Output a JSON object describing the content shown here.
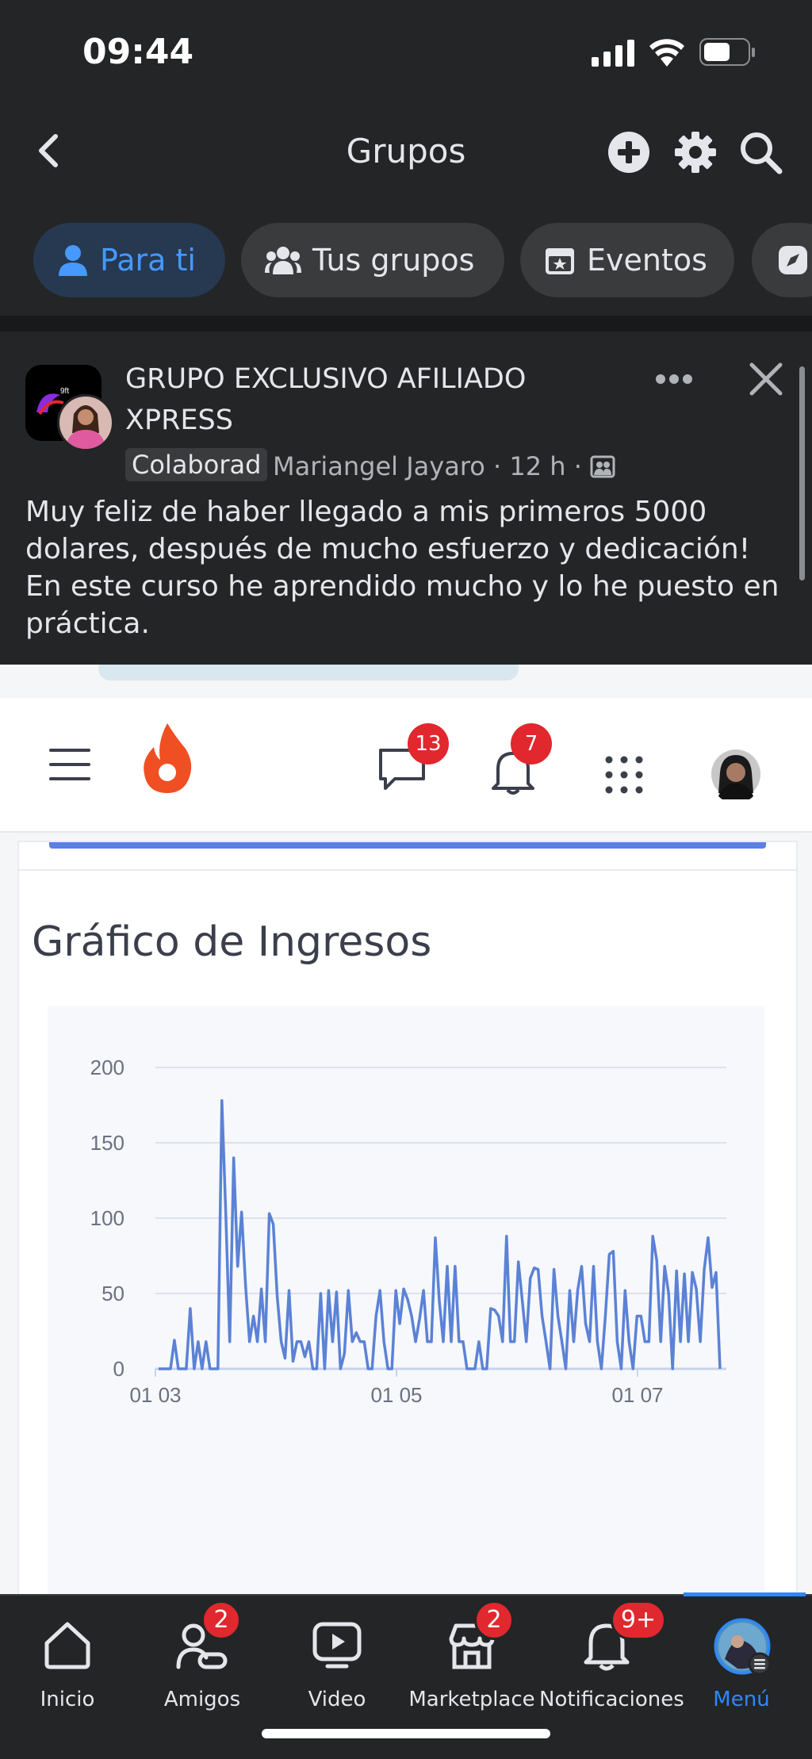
{
  "status_bar": {
    "time": "09:44"
  },
  "header": {
    "title": "Grupos",
    "back_icon": "chevron-left-icon",
    "actions": [
      "add-icon",
      "gear-icon",
      "search-icon"
    ]
  },
  "tabs": [
    {
      "label": "Para ti",
      "icon": "person-icon",
      "active": true
    },
    {
      "label": "Tus grupos",
      "icon": "people-icon",
      "active": false
    },
    {
      "label": "Eventos",
      "icon": "calendar-star-icon",
      "active": false
    },
    {
      "label": "",
      "icon": "compass-icon",
      "active": false
    }
  ],
  "post": {
    "group_name": "GRUPO EXCLUSIVO AFILIADO XPRESS",
    "badge": "Colaborad",
    "author": "Mariangel Jayaro",
    "time": "12 h",
    "separator": "·",
    "privacy_icon": "group-privacy-icon",
    "text": "Muy feliz de haber llegado a mis primeros 5000 dolares, después de mucho esfuerzo y dedicación! En este curso he aprendido mucho y lo he puesto en práctica.",
    "image": {
      "app_bar": {
        "messages_count": "13",
        "notifications_count": "7"
      },
      "chart_title": "Gráfico de Ingresos"
    }
  },
  "chart_data": {
    "type": "line",
    "title": "Gráfico de Ingresos",
    "xlabel": "",
    "ylabel": "",
    "ylim": [
      0,
      200
    ],
    "yticks": [
      0,
      50,
      100,
      150,
      200
    ],
    "xticks": [
      "01 03",
      "01 05",
      "01 07"
    ],
    "grid": true,
    "color": "#5b82d6",
    "series": [
      {
        "values": [
          0,
          0,
          0,
          0,
          19,
          0,
          0,
          0,
          40,
          0,
          18,
          0,
          18,
          0,
          0,
          0,
          178,
          102,
          18,
          140,
          68,
          104,
          55,
          18,
          35,
          18,
          53,
          18,
          103,
          96,
          48,
          18,
          7,
          52,
          5,
          18,
          18,
          8,
          18,
          0,
          0,
          50,
          0,
          52,
          18,
          51,
          0,
          10,
          52,
          18,
          24,
          18,
          18,
          0,
          0,
          35,
          52,
          18,
          0,
          0,
          52,
          30,
          53,
          46,
          35,
          18,
          33,
          52,
          18,
          18,
          87,
          45,
          18,
          68,
          18,
          68,
          18,
          18,
          0,
          0,
          0,
          18,
          0,
          0,
          40,
          39,
          35,
          18,
          88,
          18,
          18,
          71,
          45,
          18,
          60,
          67,
          66,
          35,
          18,
          0,
          66,
          35,
          18,
          0,
          52,
          18,
          52,
          68,
          30,
          18,
          68,
          18,
          0,
          35,
          76,
          78,
          18,
          0,
          52,
          18,
          0,
          35,
          35,
          18,
          18,
          88,
          72,
          18,
          68,
          50,
          0,
          65,
          18,
          63,
          18,
          64,
          53,
          18,
          66,
          87,
          54,
          64,
          0
        ]
      }
    ]
  }
}
